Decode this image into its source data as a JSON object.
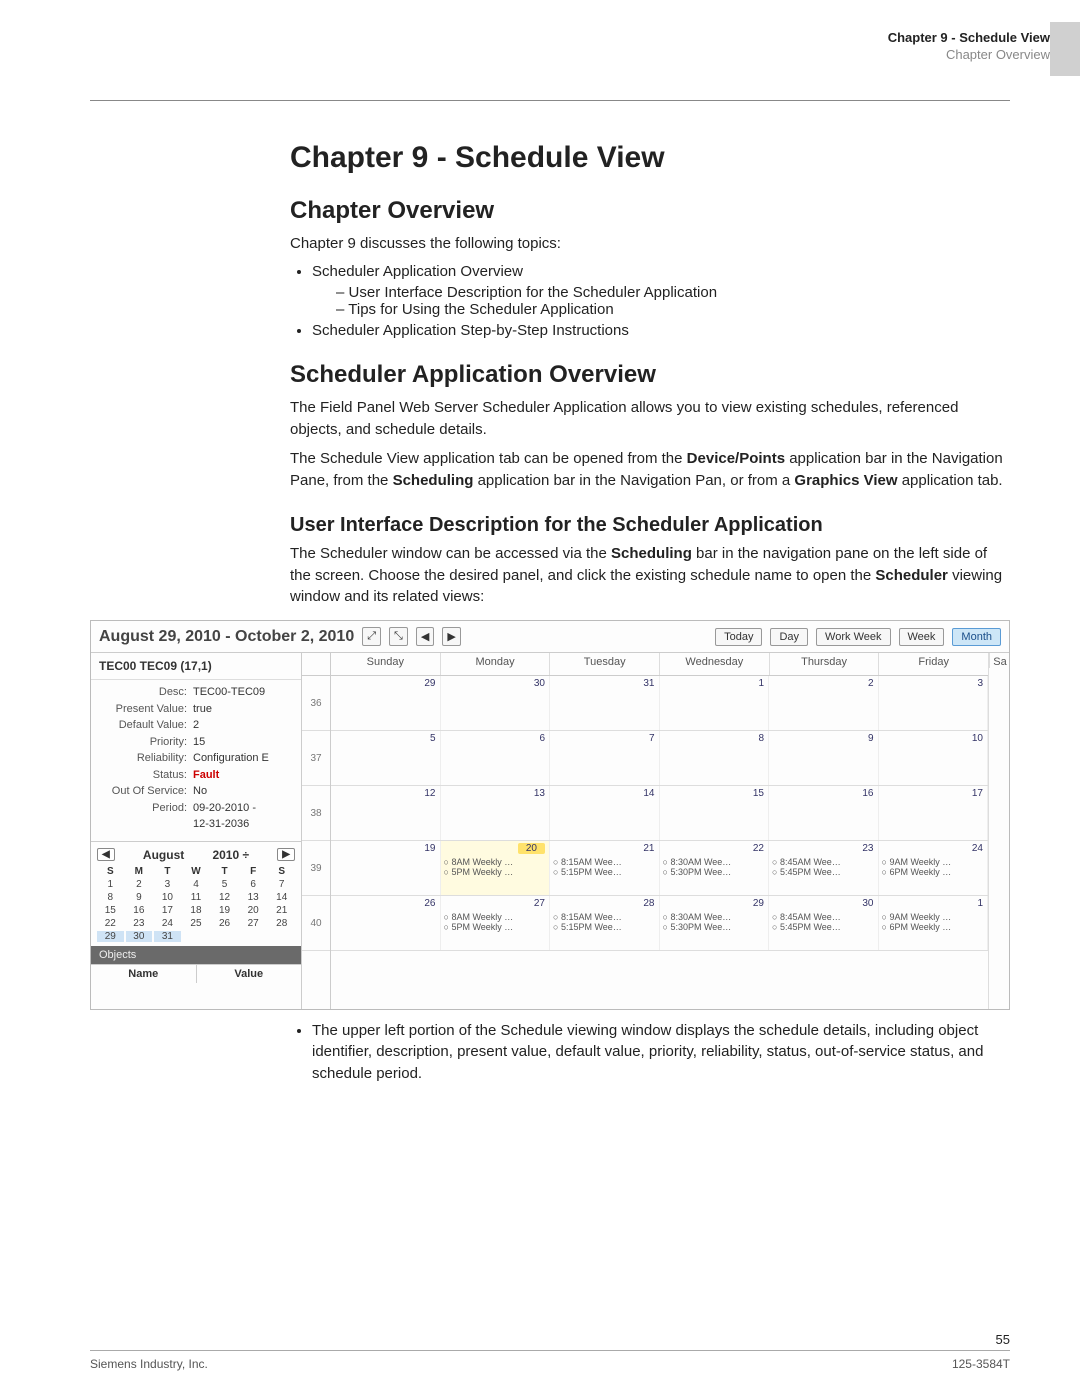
{
  "header": {
    "chapter_line": "Chapter 9 - Schedule View",
    "sub_line": "Chapter Overview"
  },
  "h1": "Chapter 9 - Schedule View",
  "overview": {
    "heading": "Chapter Overview",
    "intro": "Chapter 9 discusses the following topics:",
    "bullet1": "Scheduler Application Overview",
    "sub1": "User Interface Description for the Scheduler Application",
    "sub2": "Tips for Using the Scheduler Application",
    "bullet2": "Scheduler Application Step-by-Step Instructions"
  },
  "app": {
    "heading": "Scheduler Application Overview",
    "p1": "The Field Panel Web Server Scheduler Application allows you to view existing schedules, referenced objects, and schedule details.",
    "p2a": "The Schedule View application tab can be opened from the ",
    "p2b": "Device/Points",
    "p2c": " application bar in the Navigation Pane, from the ",
    "p2d": "Scheduling",
    "p2e": " application bar in the Navigation Pan, or from a ",
    "p2f": "Graphics View",
    "p2g": " application tab."
  },
  "ui": {
    "heading": "User Interface Description for the Scheduler Application",
    "p1a": "The Scheduler window can be accessed via the ",
    "p1b": "Scheduling",
    "p1c": " bar in the navigation pane on the left side of the screen. Choose the desired panel, and click the existing schedule name to open the ",
    "p1d": "Scheduler",
    "p1e": " viewing window and its related views:"
  },
  "shot": {
    "date_range": "August 29, 2010 - October 2, 2010",
    "toolbar": {
      "zoom_in": "⤢",
      "zoom_out": "⤡",
      "prev": "◀",
      "next": "▶",
      "today": "Today",
      "day": "Day",
      "workweek": "Work Week",
      "week": "Week",
      "month": "Month"
    },
    "panel_title": "TEC00 TEC09 (17,1)",
    "details": [
      {
        "label": "Desc:",
        "value": "TEC00-TEC09"
      },
      {
        "label": "Present Value:",
        "value": "true"
      },
      {
        "label": "Default Value:",
        "value": "2"
      },
      {
        "label": "Priority:",
        "value": "15"
      },
      {
        "label": "Reliability:",
        "value": "Configuration E"
      },
      {
        "label": "Status:",
        "value": "Fault",
        "fault": true
      },
      {
        "label": "Out Of Service:",
        "value": "No"
      },
      {
        "label": "Period:",
        "value": "09-20-2010 -"
      },
      {
        "label": "",
        "value": "12-31-2036"
      }
    ],
    "mini_cal": {
      "month": "August",
      "year": "2010 ÷",
      "prev": "◀",
      "next": "▶",
      "dow": [
        "S",
        "M",
        "T",
        "W",
        "T",
        "F",
        "S"
      ],
      "days": [
        {
          "d": "1"
        },
        {
          "d": "2"
        },
        {
          "d": "3"
        },
        {
          "d": "4"
        },
        {
          "d": "5"
        },
        {
          "d": "6"
        },
        {
          "d": "7"
        },
        {
          "d": "8"
        },
        {
          "d": "9"
        },
        {
          "d": "10"
        },
        {
          "d": "11"
        },
        {
          "d": "12"
        },
        {
          "d": "13"
        },
        {
          "d": "14"
        },
        {
          "d": "15"
        },
        {
          "d": "16"
        },
        {
          "d": "17"
        },
        {
          "d": "18"
        },
        {
          "d": "19"
        },
        {
          "d": "20"
        },
        {
          "d": "21"
        },
        {
          "d": "22"
        },
        {
          "d": "23"
        },
        {
          "d": "24"
        },
        {
          "d": "25"
        },
        {
          "d": "26"
        },
        {
          "d": "27"
        },
        {
          "d": "28"
        },
        {
          "d": "29",
          "sel": true
        },
        {
          "d": "30",
          "sel": true
        },
        {
          "d": "31",
          "sel": true
        },
        {
          "d": "",
          "off": true
        },
        {
          "d": "",
          "off": true
        },
        {
          "d": "",
          "off": true
        },
        {
          "d": "",
          "off": true
        }
      ]
    },
    "objects": {
      "bar": "Objects",
      "col1": "Name",
      "col2": "Value"
    },
    "cal": {
      "days": [
        "Sunday",
        "Monday",
        "Tuesday",
        "Wednesday",
        "Thursday",
        "Friday"
      ],
      "sat": "Sa",
      "weeks": [
        "36",
        "37",
        "38",
        "39",
        "40"
      ],
      "rows": [
        [
          {
            "n": "29"
          },
          {
            "n": "30"
          },
          {
            "n": "31"
          },
          {
            "n": "1"
          },
          {
            "n": "2"
          },
          {
            "n": "3"
          }
        ],
        [
          {
            "n": "5"
          },
          {
            "n": "6"
          },
          {
            "n": "7"
          },
          {
            "n": "8"
          },
          {
            "n": "9"
          },
          {
            "n": "10"
          }
        ],
        [
          {
            "n": "12"
          },
          {
            "n": "13"
          },
          {
            "n": "14"
          },
          {
            "n": "15"
          },
          {
            "n": "16"
          },
          {
            "n": "17"
          }
        ],
        [
          {
            "n": "19"
          },
          {
            "n": "20",
            "today": true,
            "ev": [
              "8AM Weekly …",
              "5PM Weekly …"
            ]
          },
          {
            "n": "21",
            "ev": [
              "8:15AM Wee…",
              "5:15PM Wee…"
            ]
          },
          {
            "n": "22",
            "ev": [
              "8:30AM Wee…",
              "5:30PM Wee…"
            ]
          },
          {
            "n": "23",
            "ev": [
              "8:45AM Wee…",
              "5:45PM Wee…"
            ]
          },
          {
            "n": "24",
            "ev": [
              "9AM Weekly …",
              "6PM Weekly …"
            ]
          }
        ],
        [
          {
            "n": "26"
          },
          {
            "n": "27",
            "ev": [
              "8AM Weekly …",
              "5PM Weekly …"
            ]
          },
          {
            "n": "28",
            "ev": [
              "8:15AM Wee…",
              "5:15PM Wee…"
            ]
          },
          {
            "n": "29",
            "ev": [
              "8:30AM Wee…",
              "5:30PM Wee…"
            ]
          },
          {
            "n": "30",
            "ev": [
              "8:45AM Wee…",
              "5:45PM Wee…"
            ]
          },
          {
            "n": "1",
            "ev": [
              "9AM Weekly …",
              "6PM Weekly …"
            ]
          }
        ]
      ]
    }
  },
  "after_bullet": "The upper left portion of the Schedule viewing window displays the schedule details, including object identifier, description, present value, default value, priority, reliability, status, out-of-service status, and schedule period.",
  "footer": {
    "left": "Siemens Industry, Inc.",
    "right": "125-3584T",
    "page": "55"
  }
}
